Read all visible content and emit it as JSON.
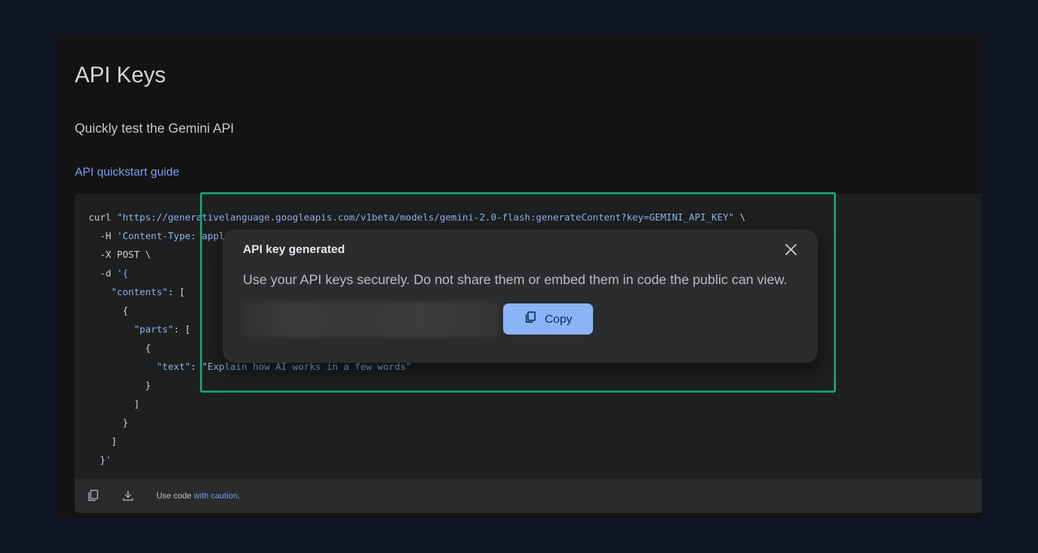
{
  "page": {
    "title": "API Keys",
    "subtitle": "Quickly test the Gemini API",
    "guide_link": "API quickstart guide"
  },
  "code": {
    "lines": [
      "curl \"https://generativelanguage.googleapis.com/v1beta/models/gemini-2.0-flash:generateContent?key=GEMINI_API_KEY\" \\",
      "  -H 'Content-Type: application/json' \\",
      "  -X POST \\",
      "  -d '{",
      "    \"contents\": [",
      "      {",
      "        \"parts\": [",
      "          {",
      "            \"text\": \"Explain how AI works in a few words\"",
      "          }",
      "        ]",
      "      }",
      "    ]",
      "  }'"
    ],
    "footer_text": "Use code ",
    "footer_link": "with caution",
    "footer_suffix": "."
  },
  "dialog": {
    "title": "API key generated",
    "message": "Use your API keys securely. Do not share them or embed them in code the public can view.",
    "copy_label": "Copy"
  },
  "icons": {
    "close": "close-icon",
    "copy": "copy-icon",
    "download": "download-icon"
  },
  "colors": {
    "accent": "#8ab4f8",
    "link": "#7b9cf0",
    "highlight": "#1aa06d",
    "background": "#0f1522"
  }
}
